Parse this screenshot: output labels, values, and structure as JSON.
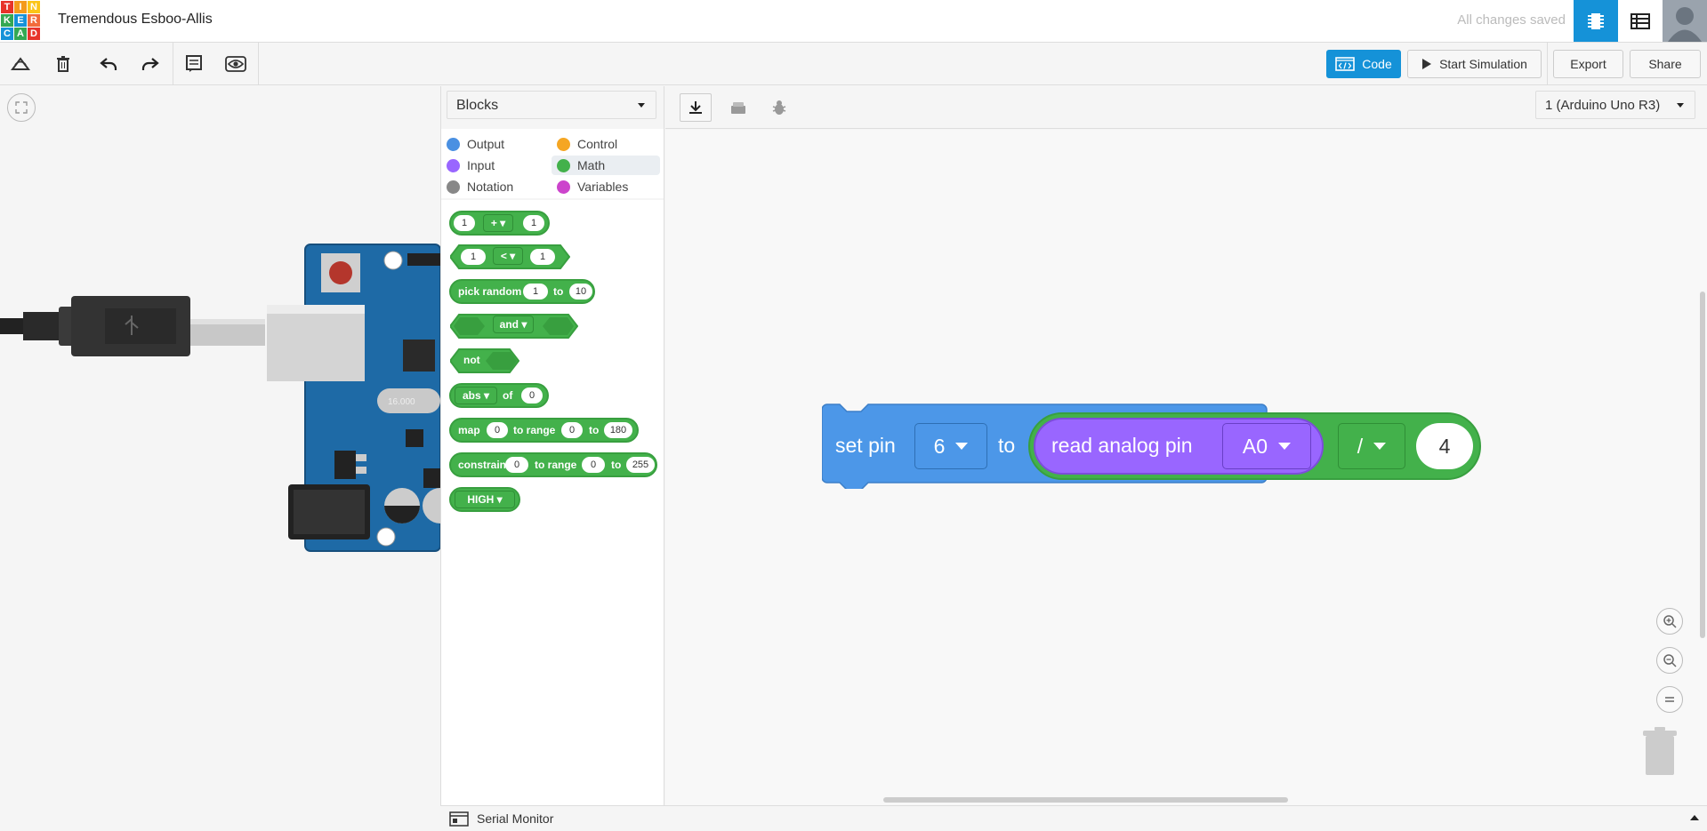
{
  "app": {
    "logo_letters": [
      "T",
      "I",
      "N",
      "K",
      "E",
      "R",
      "C",
      "A",
      "D"
    ],
    "logo_colors": [
      "#e7332a",
      "#f49a1c",
      "#fbc518",
      "#34a853",
      "#1592d8",
      "#f26b3a",
      "#1592d8",
      "#34a853",
      "#e7332a"
    ],
    "project_title": "Tremendous Esboo-Allis",
    "save_status": "All changes saved"
  },
  "topbar_icons": [
    "circuit-view-icon",
    "components-list-icon",
    "user-avatar-icon"
  ],
  "toolbar": {
    "code_label": "Code",
    "start_sim_label": "Start Simulation",
    "export_label": "Export",
    "share_label": "Share",
    "accent": "#1592d8"
  },
  "palette": {
    "dropdown_value": "Blocks",
    "categories": [
      {
        "name": "Output",
        "color": "#4a90e2"
      },
      {
        "name": "Control",
        "color": "#f5a623"
      },
      {
        "name": "Input",
        "color": "#9966ff"
      },
      {
        "name": "Math",
        "color": "#43b14b"
      },
      {
        "name": "Notation",
        "color": "#888888"
      },
      {
        "name": "Variables",
        "color": "#cc44cc"
      }
    ],
    "selected_category": "Math"
  },
  "blocks": {
    "arith": {
      "a": "1",
      "op": "+",
      "b": "1"
    },
    "compare": {
      "a": "1",
      "op": "<",
      "b": "1"
    },
    "random": {
      "label": "pick random",
      "from": "1",
      "to_label": "to",
      "to": "10"
    },
    "logic": {
      "op": "and"
    },
    "not": {
      "label": "not"
    },
    "abs": {
      "op": "abs",
      "of_label": "of",
      "value": "0"
    },
    "map": {
      "label": "map",
      "value": "0",
      "range_label": "to range",
      "from": "0",
      "to_label": "to",
      "to": "180"
    },
    "constrain": {
      "label": "constrain",
      "value": "0",
      "range_label": "to range",
      "from": "0",
      "to_label": "to",
      "to": "255"
    },
    "level": {
      "value": "HIGH"
    }
  },
  "workspace": {
    "device": "1 (Arduino Uno R3)",
    "main_block": {
      "label": "set pin",
      "pin": "6",
      "to_label": "to",
      "read_label": "read analog pin",
      "analog_pin": "A0",
      "op": "/",
      "divisor": "4"
    }
  },
  "serial_label": "Serial Monitor",
  "board_label": "16.000"
}
